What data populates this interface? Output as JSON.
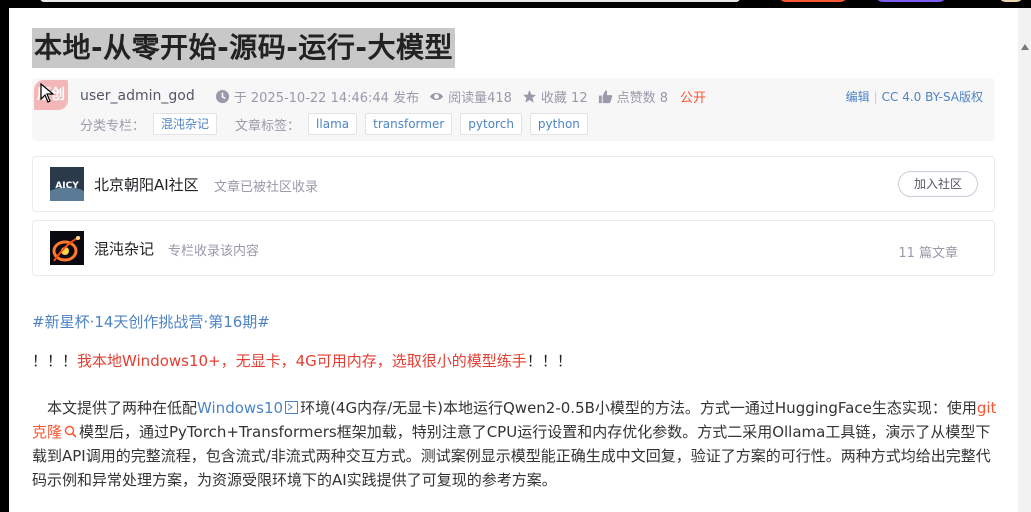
{
  "article": {
    "title": "本地-从零开始-源码-运行-大模型",
    "badge": "原创",
    "author": "user_admin_god",
    "date": "于 2025-10-22 14:46:44 发布",
    "reads": "阅读量418",
    "collects": "收藏 12",
    "likes": "点赞数 8",
    "visibility": "公开",
    "edit": "编辑",
    "license": "CC 4.0 BY-SA版权",
    "column_label": "分类专栏：",
    "column": "混沌杂记",
    "tags_label": "文章标签：",
    "tags": [
      "llama",
      "transformer",
      "pytorch",
      "python"
    ]
  },
  "community": {
    "logo_text": "AICY",
    "name": "北京朝阳AI社区",
    "desc": "文章已被社区收录",
    "join": "加入社区"
  },
  "column_card": {
    "name": "混沌杂记",
    "desc": "专栏收录该内容",
    "count": "11 篇文章"
  },
  "content": {
    "hashtag": "#新星杯·14天创作挑战营·第16期#",
    "notice_prefix": "！！！",
    "notice_text": "我本地Windows10+，无显卡，4G可用内存，选取很小的模型练手",
    "notice_suffix": "！！！",
    "p1": "本文提供了两种在低配",
    "link_windows": "Windows10",
    "p2": "环境(4G内存/无显卡)本地运行Qwen2-0.5B小模型的方法。方式一通过HuggingFace生态实现：使用",
    "link_git": "git克隆",
    "p3": "模型后，通过PyTorch+Transformers框架加载，特别注意了CPU运行设置和内存优化参数。方式二采用Ollama工具链，演示了从模型下载到API调用的完整流程，包含流式/非流式两种交互方式。测试案例显示模型能正确生成中文回复，验证了方案的可行性。两种方式均给出完整代码示例和异常处理方案，为资源受限环境下的AI实践提供了可复现的参考方案。"
  },
  "colors": {
    "link": "#4e84c4",
    "accent": "#fc5531",
    "notice": "#e33e33"
  }
}
